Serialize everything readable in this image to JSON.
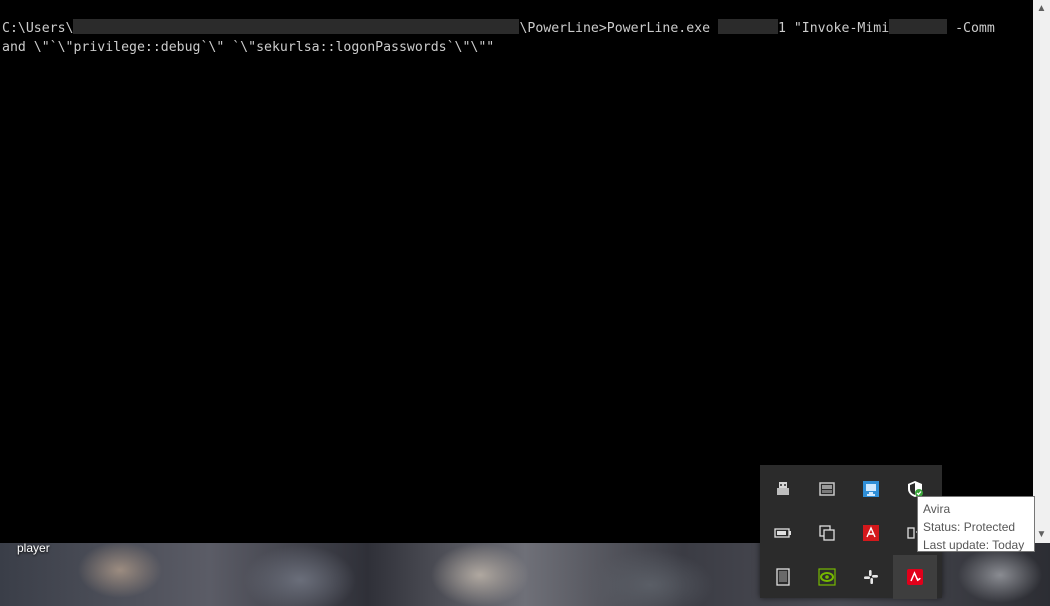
{
  "console": {
    "line1_prefix": "C:\\Users\\",
    "line1_path_suffix": "\\PowerLine>PowerLine.exe",
    "line1_arg_tail": "1 \"Invoke-Mimi",
    "line1_tail": "-Comm",
    "line2": "and \\\"`\\\"privilege::debug`\\\" `\\\"sekurlsa::logonPasswords`\\\"\\\"\""
  },
  "desktop": {
    "icon_label": "player"
  },
  "tray": {
    "icons": [
      {
        "name": "usb-drive-icon"
      },
      {
        "name": "removable-device-icon"
      },
      {
        "name": "network-app-icon"
      },
      {
        "name": "security-shield-icon"
      },
      {
        "name": "battery-icon"
      },
      {
        "name": "copy-windows-icon"
      },
      {
        "name": "adobe-icon"
      },
      {
        "name": "device-sync-icon"
      },
      {
        "name": "tablet-icon"
      },
      {
        "name": "nvidia-icon"
      },
      {
        "name": "slack-icon"
      },
      {
        "name": "avira-icon"
      }
    ]
  },
  "tooltip": {
    "title": "Avira",
    "status": "Status: Protected",
    "update": "Last update: Today"
  },
  "colors": {
    "console_bg": "#000000",
    "console_text": "#cccccc",
    "tray_bg": "#2b2b2b",
    "avira_red": "#e2001a"
  }
}
